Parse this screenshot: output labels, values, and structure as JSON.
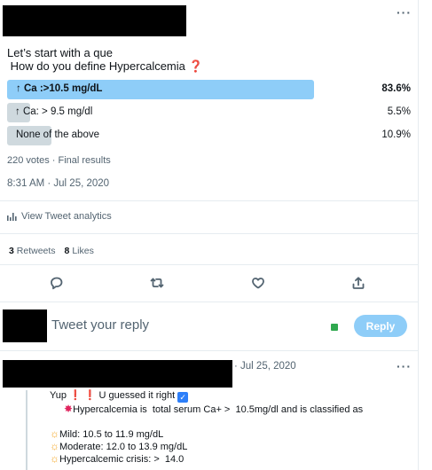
{
  "tweet": {
    "line1": "Let’s start with a que",
    "line2": " How do you define Hypercalcemia",
    "question_mark": "❓"
  },
  "poll": {
    "options": [
      {
        "label": "↑ Ca :>10.5 mg/dL",
        "percent": "83.6%",
        "share": 0.836
      },
      {
        "label": "↑ Ca: > 9.5 mg/dl",
        "percent": "5.5%",
        "share": 0.055
      },
      {
        "label": "None of the above",
        "percent": "10.9%",
        "share": 0.109
      }
    ],
    "winner_color": "#8ecdf8",
    "loser_color": "#cfd9de",
    "summary": "220 votes · Final results"
  },
  "timestamp": "8:31 AM · Jul 25, 2020",
  "analytics": "View Tweet analytics",
  "stats": {
    "retweets_count": "3",
    "retweets_label": "Retweets",
    "likes_count": "8",
    "likes_label": "Likes"
  },
  "reply_composer": {
    "placeholder": "Tweet your reply",
    "button": "Reply"
  },
  "reply": {
    "date": "· Jul 25, 2020",
    "line1_a": "Yup ",
    "line1_marks": "❗ ❗",
    "line1_b": " U guessed it right ",
    "line1_check": "✓",
    "line2_icon": "✸",
    "line2": "Hypercalcemia is  total serum Ca+ >  10.5mg/dl and is classified as",
    "sun": "☼",
    "mild": "Mild: 10.5 to 11.9 mg/dL",
    "moderate": "Moderate: 12.0 to 13.9 mg/dL",
    "crisis": "Hypercalcemic crisis: >  14.0"
  },
  "more_glyph": "···"
}
